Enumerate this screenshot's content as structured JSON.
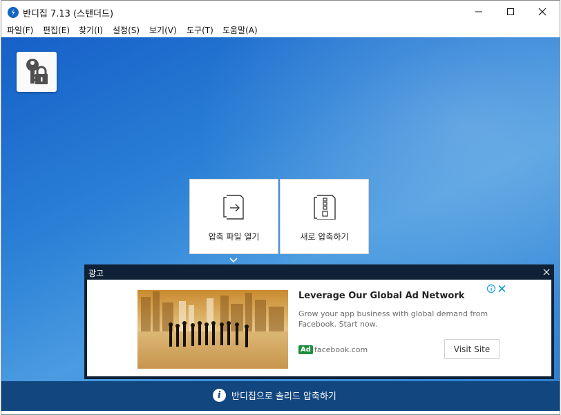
{
  "window": {
    "title": "반디집 7.13 (스탠더드)"
  },
  "menu": [
    {
      "label": "파일(F)",
      "name": "menu-file"
    },
    {
      "label": "편집(E)",
      "name": "menu-edit"
    },
    {
      "label": "찾기(I)",
      "name": "menu-find"
    },
    {
      "label": "설정(S)",
      "name": "menu-settings"
    },
    {
      "label": "보기(V)",
      "name": "menu-view"
    },
    {
      "label": "도구(T)",
      "name": "menu-tools"
    },
    {
      "label": "도움말(A)",
      "name": "menu-help"
    }
  ],
  "main": {
    "open_archive_label": "압축 파일 열기",
    "new_archive_label": "새로 압축하기"
  },
  "ad": {
    "header_label": "광고",
    "headline": "Leverage Our Global Ad Network",
    "description": "Grow your app business with global demand from Facebook. Start now.",
    "badge": "Ad",
    "domain": "facebook.com",
    "cta": "Visit Site"
  },
  "bottom": {
    "text": "반디집으로 솔리드 압축하기"
  },
  "colors": {
    "accent": "#1660c8",
    "ad_panel": "#0e2136",
    "bottom_bar": "#12467f",
    "ad_badge": "#1e8e3e"
  }
}
